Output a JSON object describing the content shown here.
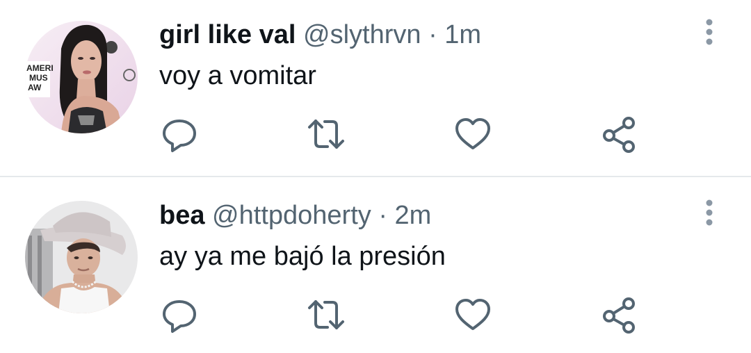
{
  "tweets": [
    {
      "display_name": "girl like val",
      "handle": "@slythrvn",
      "separator": "·",
      "time": "1m",
      "text": "voy a vomitar",
      "avatar_backdrop_text": [
        "AMERI",
        "MUS",
        "AW"
      ]
    },
    {
      "display_name": "bea",
      "handle": "@httpdoherty",
      "separator": "·",
      "time": "2m",
      "text": "ay ya me bajó la presión"
    }
  ],
  "icons": {
    "reply": "reply-icon",
    "retweet": "retweet-icon",
    "like": "heart-icon",
    "share": "share-icon",
    "more": "more-vertical-icon"
  },
  "colors": {
    "text_primary": "#0f1419",
    "text_secondary": "#536471",
    "icon": "#536471",
    "more_icon": "#8b98a5",
    "divider": "#e5e8eb",
    "background": "#ffffff"
  }
}
